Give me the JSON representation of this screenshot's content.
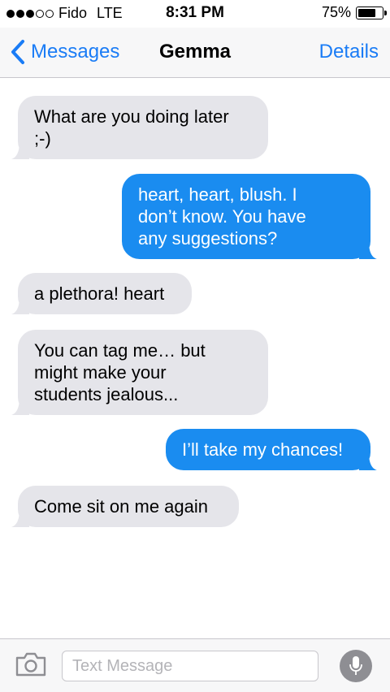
{
  "status_bar": {
    "carrier": "Fido",
    "network": "LTE",
    "time": "8:31 PM",
    "battery_percent_label": "75%",
    "battery_level": 0.75,
    "signal_bars": 3,
    "signal_total": 5
  },
  "nav": {
    "back_label": "Messages",
    "title": "Gemma",
    "details_label": "Details",
    "accent_color": "#1a7cf6"
  },
  "messages": [
    {
      "direction": "incoming",
      "lines": [
        "What are you doing later",
        ";-)"
      ]
    },
    {
      "direction": "outgoing",
      "lines": [
        "heart, heart, blush. I",
        "don’t know. You have",
        "any suggestions?"
      ]
    },
    {
      "direction": "incoming",
      "lines": [
        "a plethora! heart"
      ]
    },
    {
      "direction": "incoming",
      "lines": [
        "You can tag me… but",
        "might make your",
        "students jealous..."
      ]
    },
    {
      "direction": "outgoing",
      "lines": [
        "I’ll take my chances!"
      ]
    },
    {
      "direction": "incoming",
      "lines": [
        "Come sit on me again"
      ]
    }
  ],
  "colors": {
    "incoming_bubble": "#e5e5ea",
    "outgoing_bubble": "#1a8cf0"
  },
  "input_bar": {
    "camera_icon": "camera-icon",
    "placeholder": "Text Message",
    "value": "",
    "mic_icon": "microphone-icon"
  }
}
